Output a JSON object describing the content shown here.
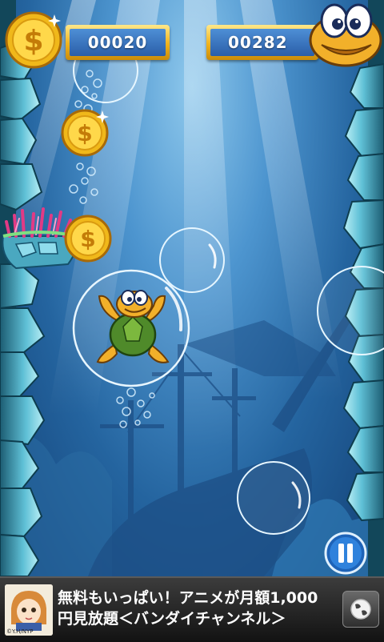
{
  "hud": {
    "coin_score": "00020",
    "best_score": "00282",
    "coin_icon": "dollar-coin-icon",
    "mascot_icon": "turtle-face-icon"
  },
  "game": {
    "player": "turtle-in-bubble",
    "collectibles": [
      "coin",
      "coin",
      "coin"
    ],
    "pause_icon": "pause-icon"
  },
  "ad": {
    "line1": "無料もいっぱい！アニメが月額1,000",
    "line2": "円見放題＜バンダイチャンネル＞",
    "thumb_caption": "©Y.H/NYP",
    "globe_icon": "globe-icon"
  },
  "colors": {
    "water_top": "#8ec8ec",
    "water_bottom": "#123f74",
    "score_box": "#f0b21c",
    "score_inner": "#2a5ea8"
  }
}
